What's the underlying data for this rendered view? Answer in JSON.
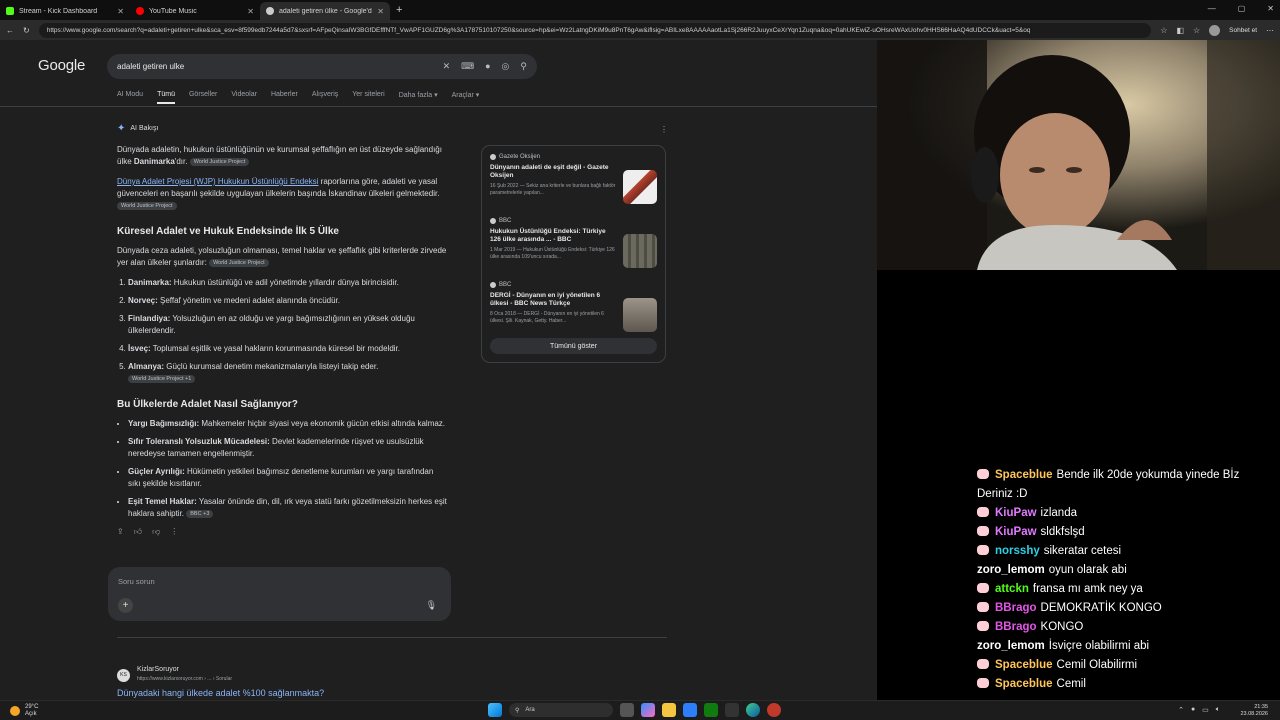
{
  "tabs": [
    {
      "title": "Stream - Kick Dashboard",
      "color": "#53fc18"
    },
    {
      "title": "YouTube Music",
      "color": "#ff0000"
    },
    {
      "title": "adaleti getiren ülke - Google'da Ar",
      "color": "#cccccc"
    }
  ],
  "address": {
    "url": "https://www.google.com/search?q=adaleti+getiren+ulke&sca_esv=8f599edb7244a5d7&sxsrf=AFpeQinsaIW3BGfDEfffNTf_VwAPF1GUZD6g%3A1787510107250&source=hp&ei=Wz2LatngDKiM9u8PnT6gAw&iflsig=ABILxe8AAAAAaotLa1Sj266R2JuuyxCeXrYqn1Zuqna&oq=0ahUKEwiZ-uOHsreWAxUohv0HHS66HaAQ4dUDCCk&uact=5&oq",
    "chat_button": "Sohbet et"
  },
  "google": {
    "logo": "Google",
    "query": "adaleti getiren ulke",
    "tabs": [
      "AI Modu",
      "Tümü",
      "Görseller",
      "Videolar",
      "Haberler",
      "Alışveriş",
      "Yer siteleri",
      "Daha fazla ▾",
      "Araçlar ▾"
    ]
  },
  "ai": {
    "header": "AI Bakışı",
    "p1_a": "Dünyada adaletin, hukukun üstünlüğünün ve kurumsal şeffaflığın en üst düzeyde sağlandığı ülke ",
    "p1_bold": "Danimarka",
    "p1_b": "'dır.",
    "chip": "World Justice Project",
    "p2_link": "Dünya Adalet Projesi (WJP) Hukukun Üstünlüğü Endeksi",
    "p2_text": " raporlarına göre, adaleti ve yasal güvenceleri en başarılı şekilde uygulayan ülkelerin başında İskandinav ülkeleri gelmektedir.",
    "h1": "Küresel Adalet ve Hukuk Endeksinde İlk 5 Ülke",
    "p3": "Dünyada ceza adaleti, yolsuzluğun olmaması, temel haklar ve şeffaflık gibi kriterlerde zirvede yer alan ülkeler şunlardır:",
    "list": [
      {
        "b": "Danimarka:",
        "t": " Hukukun üstünlüğü ve adil yönetimde yıllardır dünya birincisidir."
      },
      {
        "b": "Norveç:",
        "t": " Şeffaf yönetim ve medeni adalet alanında öncüdür."
      },
      {
        "b": "Finlandiya:",
        "t": " Yolsuzluğun en az olduğu ve yargı bağımsızlığının en yüksek olduğu ülkelerdendir."
      },
      {
        "b": "İsveç:",
        "t": " Toplumsal eşitlik ve yasal hakların korunmasında küresel bir modeldir."
      },
      {
        "b": "Almanya:",
        "t": " Güçlü kurumsal denetim mekanizmalarıyla listeyi takip eder."
      }
    ],
    "chip_plus": "World Justice Project +1",
    "h2": "Bu Ülkelerde Adalet Nasıl Sağlanıyor?",
    "bullets": [
      {
        "b": "Yargı Bağımsızlığı:",
        "t": " Mahkemeler hiçbir siyasi veya ekonomik gücün etkisi altında kalmaz."
      },
      {
        "b": "Sıfır Toleranslı Yolsuzluk Mücadelesi:",
        "t": " Devlet kademelerinde rüşvet ve usulsüzlük neredeyse tamamen engellenmiştir."
      },
      {
        "b": "Güçler Ayrılığı:",
        "t": " Hükümetin yetkileri bağımsız denetleme kurumları ve yargı tarafından sıkı şekilde kısıtlanır."
      },
      {
        "b": "Eşit Temel Haklar:",
        "t": " Yasalar önünde din, dil, ırk veya statü farkı gözetilmeksizin herkes eşit haklara sahiptir."
      }
    ],
    "chip_bbc": "BBC +3"
  },
  "sources": [
    {
      "pub": "Gazete Oksijen",
      "title": "Dünyanın adaleti de eşit değil - Gazete Oksijen",
      "snippet": "16 Şub 2022 — Sekiz ana kriterle ve bunlara bağlı faktör parametrelerle yapılan...",
      "thumb": "#e8e0d8"
    },
    {
      "pub": "BBC",
      "title": "Hukukun Üstünlüğü Endeksi: Türkiye 126 ülke arasında ... - BBC",
      "snippet": "1 Mar 2019 — Hukukun Üstünlüğü Endeksi: Türkiye 126 ülke arasında 109'uncu sırada...",
      "thumb": "#6b6a5e"
    },
    {
      "pub": "BBC",
      "title": "DERGİ - Dünyanın en iyi yönetilen 6 ülkesi - BBC News Türkçe",
      "snippet": "8 Oca 2018 — DERGİ - Dünyanın en iyi yönetilen 6 ülkesi. Şili. Kaynak, Getty. Haber...",
      "thumb": "#8a7f72"
    }
  ],
  "show_all": "Tümünü göster",
  "ask_placeholder": "Soru sorun",
  "result": {
    "badge": "KS",
    "site": "KizlarSoruyor",
    "url": "https://www.kizlarsoruyor.com › ... › Sorular",
    "title": "Dünyadaki hangi ülkede adalet %100 sağlanmakta?"
  },
  "chat": [
    {
      "user": "Spaceblue",
      "color": "#ffc65c",
      "text": "Bende ilk 20de yokumda yinede Bİz Deriniz :D",
      "icon": true
    },
    {
      "user": "KiuPaw",
      "color": "#e27aff",
      "text": "izlanda",
      "icon": true
    },
    {
      "user": "KiuPaw",
      "color": "#e27aff",
      "text": "sldkfslşd",
      "icon": true
    },
    {
      "user": "norsshy",
      "color": "#2ed0e6",
      "text": "sikeratar cetesi",
      "icon": true
    },
    {
      "user": "zoro_lemom",
      "color": "#ffffff",
      "text": "oyun olarak abi",
      "icon": false
    },
    {
      "user": "attckn",
      "color": "#53fc18",
      "text": "fransa mı amk ney ya",
      "icon": true
    },
    {
      "user": "BBrago",
      "color": "#e256e8",
      "text": "DEMOKRATİK KONGO",
      "icon": true
    },
    {
      "user": "BBrago",
      "color": "#e256e8",
      "text": "KONGO",
      "icon": true
    },
    {
      "user": "zoro_lemom",
      "color": "#ffffff",
      "text": "İsviçre olabilirmi abi",
      "icon": false
    },
    {
      "user": "Spaceblue",
      "color": "#ffc65c",
      "text": "Cemil Olabilirmi",
      "icon": true
    },
    {
      "user": "Spaceblue",
      "color": "#ffc65c",
      "text": "Cemil",
      "icon": true
    }
  ],
  "taskbar": {
    "temp": "29°C",
    "weather": "Açık",
    "search": "Ara",
    "time": "21:35",
    "date": "23.08.2026"
  }
}
